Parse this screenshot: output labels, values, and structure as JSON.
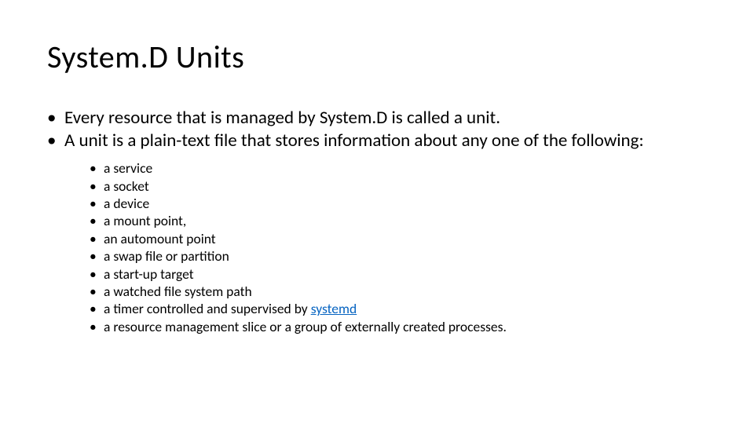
{
  "title": "System.D Units",
  "bullets": [
    "Every resource that is managed by System.D is called a unit.",
    "A unit is a plain-text file that stores information about any one of the following:"
  ],
  "sub_bullets": [
    "a service",
    "a socket",
    "a device",
    "a mount point,",
    "an automount point",
    "a swap file or partition",
    "a start-up target",
    "a watched file system path"
  ],
  "sub_bullet_with_link": {
    "prefix": "a timer controlled and supervised by ",
    "link_text": "systemd"
  },
  "sub_bullet_last": "a resource management slice or a group of externally created processes."
}
